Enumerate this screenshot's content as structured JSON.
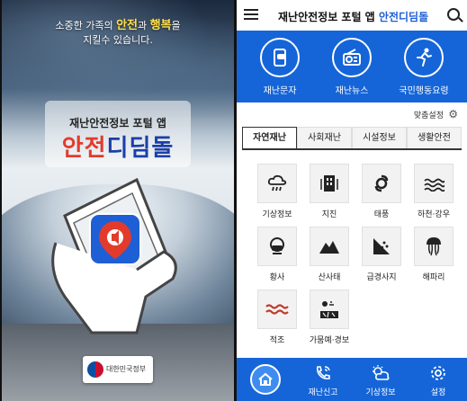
{
  "splash": {
    "tagline_prefix": "소중한 가족의",
    "tagline_hl1": "안전",
    "tagline_mid": "과",
    "tagline_hl2": "행복",
    "tagline_suffix": "을",
    "tagline_line2": "지킬수 있습니다.",
    "subtitle": "재난안전정보 포털 앱",
    "title_red": "안전",
    "title_rest": "디딤돌",
    "gov_label": "대한민국정부"
  },
  "app": {
    "title_prefix": "재난안전정보 포털 앱",
    "title_brand": "안전디딤돌",
    "quick": [
      {
        "label": "재난문자",
        "icon": "phone-message-icon"
      },
      {
        "label": "재난뉴스",
        "icon": "radio-icon"
      },
      {
        "label": "국민행동요령",
        "icon": "running-person-icon"
      }
    ],
    "custom_settings": "맞춤설정",
    "tabs": [
      "자연재난",
      "사회재난",
      "시설정보",
      "생활안전"
    ],
    "active_tab": "자연재난",
    "categories": [
      {
        "label": "기상정보",
        "icon": "cloud-rain-icon"
      },
      {
        "label": "지진",
        "icon": "building-icon"
      },
      {
        "label": "태풍",
        "icon": "typhoon-icon"
      },
      {
        "label": "하천·강우",
        "icon": "water-waves-icon"
      },
      {
        "label": "황사",
        "icon": "mask-face-icon"
      },
      {
        "label": "산사태",
        "icon": "landslide-icon"
      },
      {
        "label": "급경사지",
        "icon": "steep-slope-icon"
      },
      {
        "label": "해파리",
        "icon": "jellyfish-icon"
      },
      {
        "label": "적조",
        "icon": "red-tide-icon"
      },
      {
        "label": "가뭄예·경보",
        "icon": "drought-icon"
      }
    ],
    "bottom_nav": [
      {
        "label": "",
        "icon": "home-icon"
      },
      {
        "label": "재난신고",
        "icon": "phone-report-icon"
      },
      {
        "label": "기상정보",
        "icon": "weather-icon"
      },
      {
        "label": "설정",
        "icon": "gear-icon"
      }
    ],
    "colors": {
      "primary": "#1565d8",
      "brand_red": "#e23b2c",
      "brand_blue": "#1b3fa8"
    }
  }
}
